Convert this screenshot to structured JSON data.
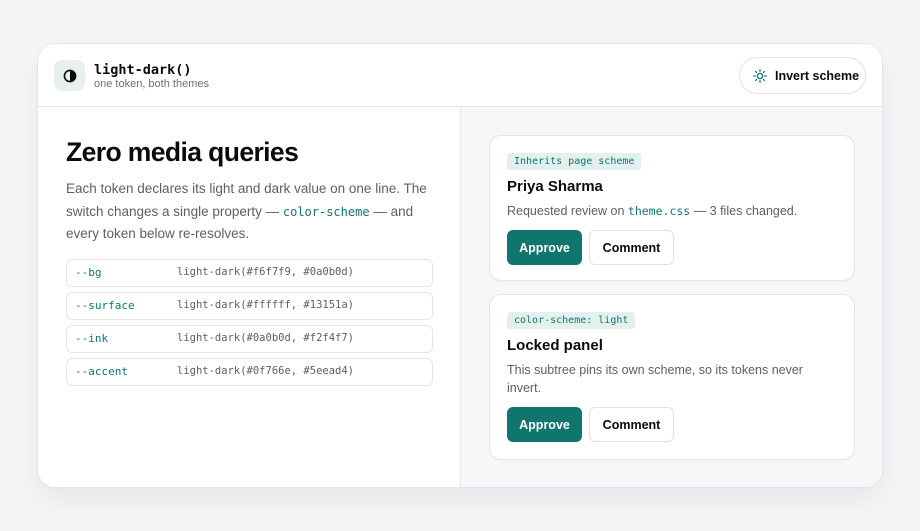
{
  "header": {
    "icon": "contrast-icon",
    "title": "light-dark()",
    "subtitle": "one token, both themes",
    "invert_button": {
      "icon": "sun-icon",
      "label": "Invert scheme"
    }
  },
  "left": {
    "headline": "Zero media queries",
    "desc": {
      "part1": "Each token declares its light and dark value on one line. The switch changes a single property — ",
      "code": "color-scheme",
      "part2": " — and every token below re-resolves."
    },
    "tokens": [
      {
        "name": "--bg",
        "value": "light-dark(#f6f7f9, #0a0b0d)"
      },
      {
        "name": "--surface",
        "value": "light-dark(#ffffff, #13151a)"
      },
      {
        "name": "--ink",
        "value": "light-dark(#0a0b0d, #f2f4f7)"
      },
      {
        "name": "--accent",
        "value": "light-dark(#0f766e, #5eead4)"
      }
    ]
  },
  "panels": [
    {
      "tag": "Inherits page scheme",
      "title": "Priya Sharma",
      "text_before": "Requested review on ",
      "text_code": "theme.css",
      "text_after": " — 3 files changed.",
      "approve": "Approve",
      "comment": "Comment"
    },
    {
      "tag": "color-scheme: light",
      "title": "Locked panel",
      "text": "This subtree pins its own scheme, so its tokens never invert.",
      "approve": "Approve",
      "comment": "Comment"
    }
  ],
  "colors": {
    "accent": "#0f766e",
    "ink": "#0a0b0d",
    "bg": "#f6f7f9",
    "surface": "#ffffff"
  }
}
